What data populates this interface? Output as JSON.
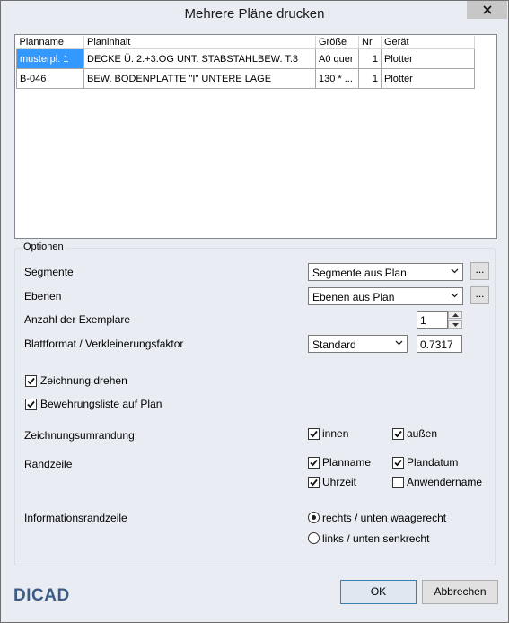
{
  "window": {
    "title": "Mehrere Pläne drucken"
  },
  "plans": {
    "columns": [
      "Planname",
      "Planinhalt",
      "Größe",
      "Nr.",
      "Gerät"
    ],
    "rows": [
      {
        "planname": "musterpl. 1",
        "planinhalt": "DECKE Ü. 2.+3.OG UNT. STABSTAHLBEW. T.3",
        "groesse": "A0 quer",
        "nr": "1",
        "geraet": "Plotter"
      },
      {
        "planname": "B-046",
        "planinhalt": "BEW. BODENPLATTE \"I\" UNTERE LAGE",
        "groesse": "130 * ...",
        "nr": "1",
        "geraet": "Plotter"
      }
    ]
  },
  "options": {
    "legend": "Optionen",
    "segmente": {
      "label": "Segmente",
      "value": "Segmente aus Plan",
      "button": "..."
    },
    "ebenen": {
      "label": "Ebenen",
      "value": "Ebenen aus Plan",
      "button": "..."
    },
    "exemplare": {
      "label": "Anzahl der Exemplare",
      "value": "1"
    },
    "blattformat": {
      "label": "Blattformat / Verkleinerungsfaktor",
      "value": "Standard",
      "factor": "0.7317"
    },
    "zeichnung_drehen": {
      "label": "Zeichnung drehen",
      "checked": true
    },
    "bewehrungsliste": {
      "label": "Bewehrungsliste auf Plan",
      "checked": true
    },
    "zeichnungsumrandung": {
      "label": "Zeichnungsumrandung",
      "innen": {
        "label": "innen",
        "checked": true
      },
      "aussen": {
        "label": "außen",
        "checked": true
      }
    },
    "randzeile": {
      "label": "Randzeile",
      "planname": {
        "label": "Planname",
        "checked": true
      },
      "plandatum": {
        "label": "Plandatum",
        "checked": true
      },
      "uhrzeit": {
        "label": "Uhrzeit",
        "checked": true
      },
      "anwendername": {
        "label": "Anwendername",
        "checked": false
      }
    },
    "informationsrandzeile": {
      "label": "Informationsrandzeile",
      "options": [
        {
          "label": "rechts / unten waagerecht",
          "selected": true
        },
        {
          "label": "links / unten senkrecht",
          "selected": false
        }
      ]
    }
  },
  "footer": {
    "logo": "DICAD",
    "ok": "OK",
    "cancel": "Abbrechen"
  },
  "colors": {
    "selection": "#3399ff",
    "background": "#e9edf3",
    "logo": "#3c5b84"
  }
}
